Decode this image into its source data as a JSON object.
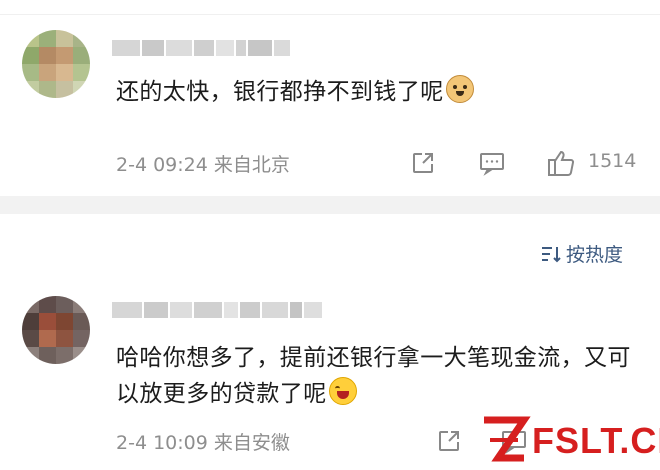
{
  "comments": [
    {
      "text": "还的太快，银行都挣不到钱了呢",
      "emoji": "doge-emoji",
      "time": "2-4 09:24",
      "location": "来自北京",
      "likes": "1514"
    },
    {
      "text": "哈哈你想多了，提前还银行拿一大笔现金流，又可以放更多的贷款了呢",
      "emoji": "grin-emoji",
      "time": "2-4 10:09",
      "location": "来自安徽"
    }
  ],
  "sort": {
    "label": "按热度"
  },
  "icons": {
    "share": "share-icon",
    "reply": "comment-icon",
    "like": "thumbs-up-icon",
    "sort": "sort-icon"
  },
  "watermark": {
    "text": "FSLT.CN"
  },
  "colors": {
    "accent": "#3d5a80",
    "meta": "#8e8e8e",
    "watermark": "#d61f1f"
  }
}
